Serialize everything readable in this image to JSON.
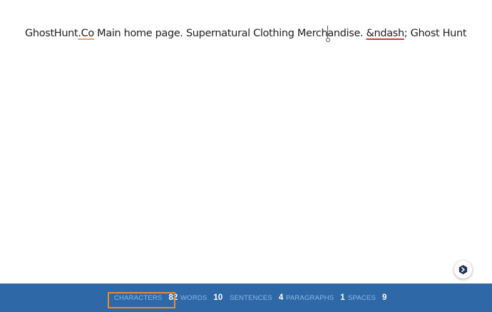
{
  "editor": {
    "segments": [
      {
        "text": "GhostHunt",
        "style": "plain"
      },
      {
        "text": ".Co",
        "style": "orange-underline"
      },
      {
        "text": " Main home page. Supernatural Clothing Merch",
        "style": "plain"
      },
      {
        "text": "andise. ",
        "style": "plain"
      },
      {
        "text": "&ndash",
        "style": "red-underline"
      },
      {
        "text": "; Ghost Hunt",
        "style": "plain"
      }
    ]
  },
  "assist_button": {
    "icon": "chevron-right-icon"
  },
  "statusbar": {
    "characters": {
      "label": "CHARACTERS",
      "value": "82"
    },
    "words": {
      "label": "WORDS",
      "value": "10"
    },
    "sentences": {
      "label": "SENTENCES",
      "value": "4"
    },
    "paragraphs": {
      "label": "PARAGRAPHS",
      "value": "1"
    },
    "spaces": {
      "label": "SPACES",
      "value": "9"
    }
  },
  "colors": {
    "statusbar_bg": "#2e68a7",
    "label": "#8fb9e8",
    "value": "#ffffff",
    "highlight": "#f08a2a",
    "spell_error": "#e0303a",
    "grammar_hint": "#f0a060"
  }
}
